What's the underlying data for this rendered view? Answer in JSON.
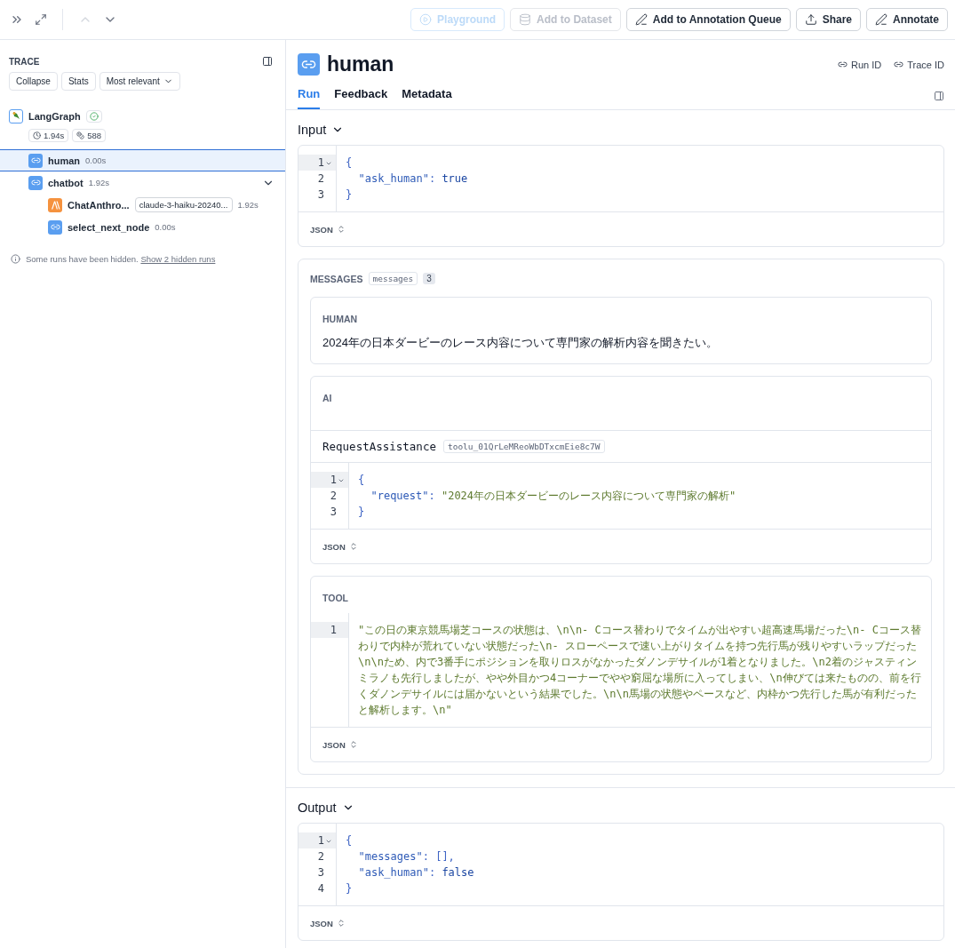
{
  "toolbar": {
    "buttons": [
      {
        "label": "Playground",
        "kind": "playground",
        "disabled": true
      },
      {
        "label": "Add to Dataset",
        "kind": "dataset",
        "disabled": true
      },
      {
        "label": "Add to Annotation Queue",
        "kind": "annotate",
        "disabled": false
      },
      {
        "label": "Share",
        "kind": "share",
        "disabled": false
      },
      {
        "label": "Annotate",
        "kind": "annotate",
        "disabled": false
      }
    ],
    "prev_disabled": true
  },
  "sidebar": {
    "title": "TRACE",
    "filters": [
      {
        "label": "Collapse",
        "dropdown": false
      },
      {
        "label": "Stats",
        "dropdown": false
      },
      {
        "label": "Most relevant",
        "dropdown": true
      }
    ],
    "tree": [
      {
        "name": "LangGraph",
        "kind": "graph",
        "succeeded": true,
        "latency": "1.94s",
        "tokens": "588",
        "selected": false,
        "children": [
          {
            "name": "human",
            "kind": "chain",
            "duration": "0.00s",
            "selected": true
          },
          {
            "name": "chatbot",
            "kind": "chain",
            "duration": "1.92s",
            "selected": false,
            "expanded": true,
            "children": [
              {
                "name": "ChatAnthro...",
                "kind": "llm",
                "tag": "claude-3-haiku-20240...",
                "duration": "1.92s",
                "selected": false
              },
              {
                "name": "select_next_node",
                "kind": "chain",
                "duration": "0.00s",
                "selected": false
              }
            ]
          }
        ]
      }
    ],
    "notice": {
      "text": "Some runs have been hidden.",
      "link": "Show 2 hidden runs"
    }
  },
  "run": {
    "title": "human",
    "links": [
      "Run ID",
      "Trace ID"
    ],
    "tabs": [
      {
        "label": "Run",
        "selected": true
      },
      {
        "label": "Feedback",
        "selected": false
      },
      {
        "label": "Metadata",
        "selected": false
      }
    ],
    "input": {
      "title": "Input",
      "format": "JSON",
      "lines": [
        {
          "number": "1",
          "active": true,
          "foldable": true,
          "tokens": [
            {
              "kind": "punct",
              "text": "{"
            }
          ]
        },
        {
          "number": "2",
          "active": false,
          "foldable": false,
          "tokens": [
            {
              "kind": "key",
              "text": "  \"ask_human\""
            },
            {
              "kind": "punct",
              "text": ": "
            },
            {
              "kind": "literal",
              "text": "true"
            }
          ]
        },
        {
          "number": "3",
          "active": false,
          "foldable": false,
          "tokens": [
            {
              "kind": "punct",
              "text": "}"
            }
          ]
        }
      ]
    },
    "messages": {
      "label": "MESSAGES",
      "tag": "messages",
      "count": "3",
      "items": [
        {
          "kind": "text",
          "role": "HUMAN",
          "content": "2024年の日本ダービーのレース内容について専門家の解析内容を聞きたい。"
        },
        {
          "kind": "tool_call",
          "role": "AI",
          "function": "RequestAssistance",
          "call_id": "toolu_01QrLeMReoWbDTxcmEie8c7W",
          "format": "JSON",
          "lines": [
            {
              "number": "1",
              "active": true,
              "foldable": true,
              "tokens": [
                {
                  "kind": "punct",
                  "text": "{"
                }
              ]
            },
            {
              "number": "2",
              "active": false,
              "foldable": false,
              "tokens": [
                {
                  "kind": "key",
                  "text": "  \"request\""
                },
                {
                  "kind": "punct",
                  "text": ": "
                },
                {
                  "kind": "string",
                  "text": "\"2024年の日本ダービーのレース内容について専門家の解析\""
                }
              ]
            },
            {
              "number": "3",
              "active": false,
              "foldable": false,
              "tokens": [
                {
                  "kind": "punct",
                  "text": "}"
                }
              ]
            }
          ]
        },
        {
          "kind": "tool",
          "role": "TOOL",
          "format": "JSON",
          "lines": [
            {
              "number": "1",
              "active": true,
              "foldable": false,
              "tokens": [
                {
                  "kind": "string",
                  "text": "\"この日の東京競馬場芝コースの状態は、\\n\\n- Cコース替わりでタイムが出やすい超高速馬場だった\\n- Cコース替わりで内枠が荒れていない状態だった\\n- スローペースで速い上がりタイムを持つ先行馬が残りやすいラップだった\\n\\nため、内で3番手にポジションを取りロスがなかったダノンデサイルが1着となりました。\\n2着のジャスティンミラノも先行しましたが、やや外目かつ4コーナーでやや窮屈な場所に入ってしまい、\\n伸びては来たものの、前を行くダノンデサイルには届かないという結果でした。\\n\\n馬場の状態やペースなど、内枠かつ先行した馬が有利だったと解析します。\\n\""
                }
              ]
            }
          ]
        }
      ]
    },
    "output": {
      "title": "Output",
      "format": "JSON",
      "lines": [
        {
          "number": "1",
          "active": true,
          "foldable": true,
          "tokens": [
            {
              "kind": "punct",
              "text": "{"
            }
          ]
        },
        {
          "number": "2",
          "active": false,
          "foldable": false,
          "tokens": [
            {
              "kind": "key",
              "text": "  \"messages\""
            },
            {
              "kind": "punct",
              "text": ": [],"
            }
          ]
        },
        {
          "number": "3",
          "active": false,
          "foldable": false,
          "tokens": [
            {
              "kind": "key",
              "text": "  \"ask_human\""
            },
            {
              "kind": "punct",
              "text": ": "
            },
            {
              "kind": "literal",
              "text": "false"
            }
          ]
        },
        {
          "number": "4",
          "active": false,
          "foldable": false,
          "tokens": [
            {
              "kind": "punct",
              "text": "}"
            }
          ]
        }
      ]
    }
  }
}
